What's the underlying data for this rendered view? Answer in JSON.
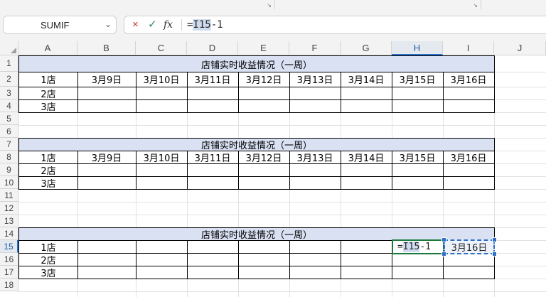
{
  "namebox": {
    "value": "SUMIF"
  },
  "formula_bar": {
    "prefix": "=",
    "ref": "I15",
    "suffix": "-1",
    "cancel_icon": "×",
    "enter_icon": "✓",
    "fx_label": "fx"
  },
  "columns": [
    "A",
    "B",
    "C",
    "D",
    "E",
    "F",
    "G",
    "H",
    "I",
    "J"
  ],
  "rows": [
    "1",
    "2",
    "3",
    "4",
    "5",
    "6",
    "7",
    "8",
    "9",
    "10",
    "11",
    "12",
    "13",
    "14",
    "15",
    "16",
    "17",
    "18"
  ],
  "tables": [
    {
      "title": "店铺实时收益情况（一周）",
      "dates": [
        "3月9日",
        "3月10日",
        "3月11日",
        "3月12日",
        "3月13日",
        "3月14日",
        "3月15日",
        "3月16日"
      ],
      "stores": [
        "1店",
        "2店",
        "3店"
      ]
    },
    {
      "title": "店铺实时收益情况（一周）",
      "dates": [
        "3月9日",
        "3月10日",
        "3月11日",
        "3月12日",
        "3月13日",
        "3月14日",
        "3月15日",
        "3月16日"
      ],
      "stores": [
        "1店",
        "2店",
        "3店"
      ]
    },
    {
      "title": "店铺实时收益情况（一周）",
      "stores": [
        "1店",
        "2店",
        "3店"
      ],
      "edit_cell_prefix": "=",
      "edit_cell_ref": "I15",
      "edit_cell_suffix": "-1",
      "ref_cell_value": "3月16日"
    }
  ],
  "selected": {
    "column": "H",
    "row": "15"
  }
}
